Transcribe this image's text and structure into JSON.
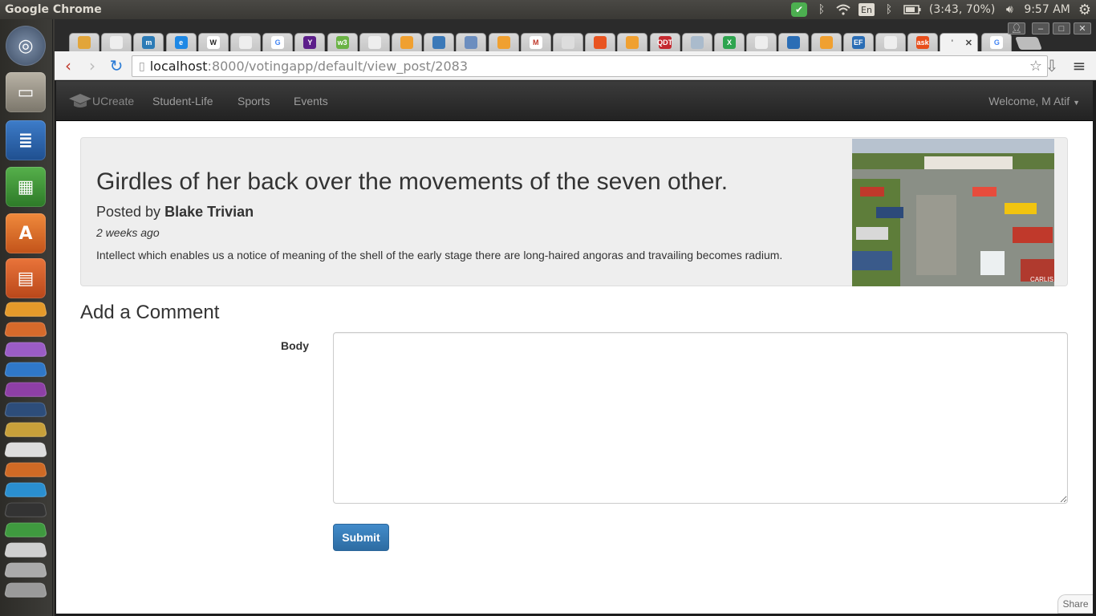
{
  "top_panel": {
    "app_title": "Google Chrome",
    "battery": "(3:43, 70%)",
    "keyboard_lang": "En",
    "clock": "9:57 AM"
  },
  "browser": {
    "url_host": "localhost",
    "url_path": ":8000/votingapp/default/view_post/2083",
    "tabs": [
      "",
      "",
      "m",
      "e",
      "W",
      "",
      "G",
      "Y",
      "w3",
      "",
      "",
      "",
      "",
      "",
      "M",
      "",
      "",
      "",
      "QDT",
      "",
      "X",
      "",
      "",
      "",
      "EF",
      "",
      "ask",
      "'",
      "G"
    ]
  },
  "navbar": {
    "brand": "UCreate",
    "links": [
      "Student-Life",
      "Sports",
      "Events"
    ],
    "welcome": "Welcome, M Atif"
  },
  "post": {
    "title": "Girdles of her back over the movements of the seven other.",
    "posted_by_prefix": "Posted by",
    "author": "Blake Trivian",
    "time": "2 weeks ago",
    "body": "Intellect which enables us a notice of meaning of the shell of the early stage there are long-haired angoras and travailing becomes radium.",
    "image_caption": "CARLIS"
  },
  "comment_form": {
    "heading": "Add a Comment",
    "body_label": "Body",
    "body_value": "",
    "submit_label": "Submit"
  },
  "share_label": "Share"
}
